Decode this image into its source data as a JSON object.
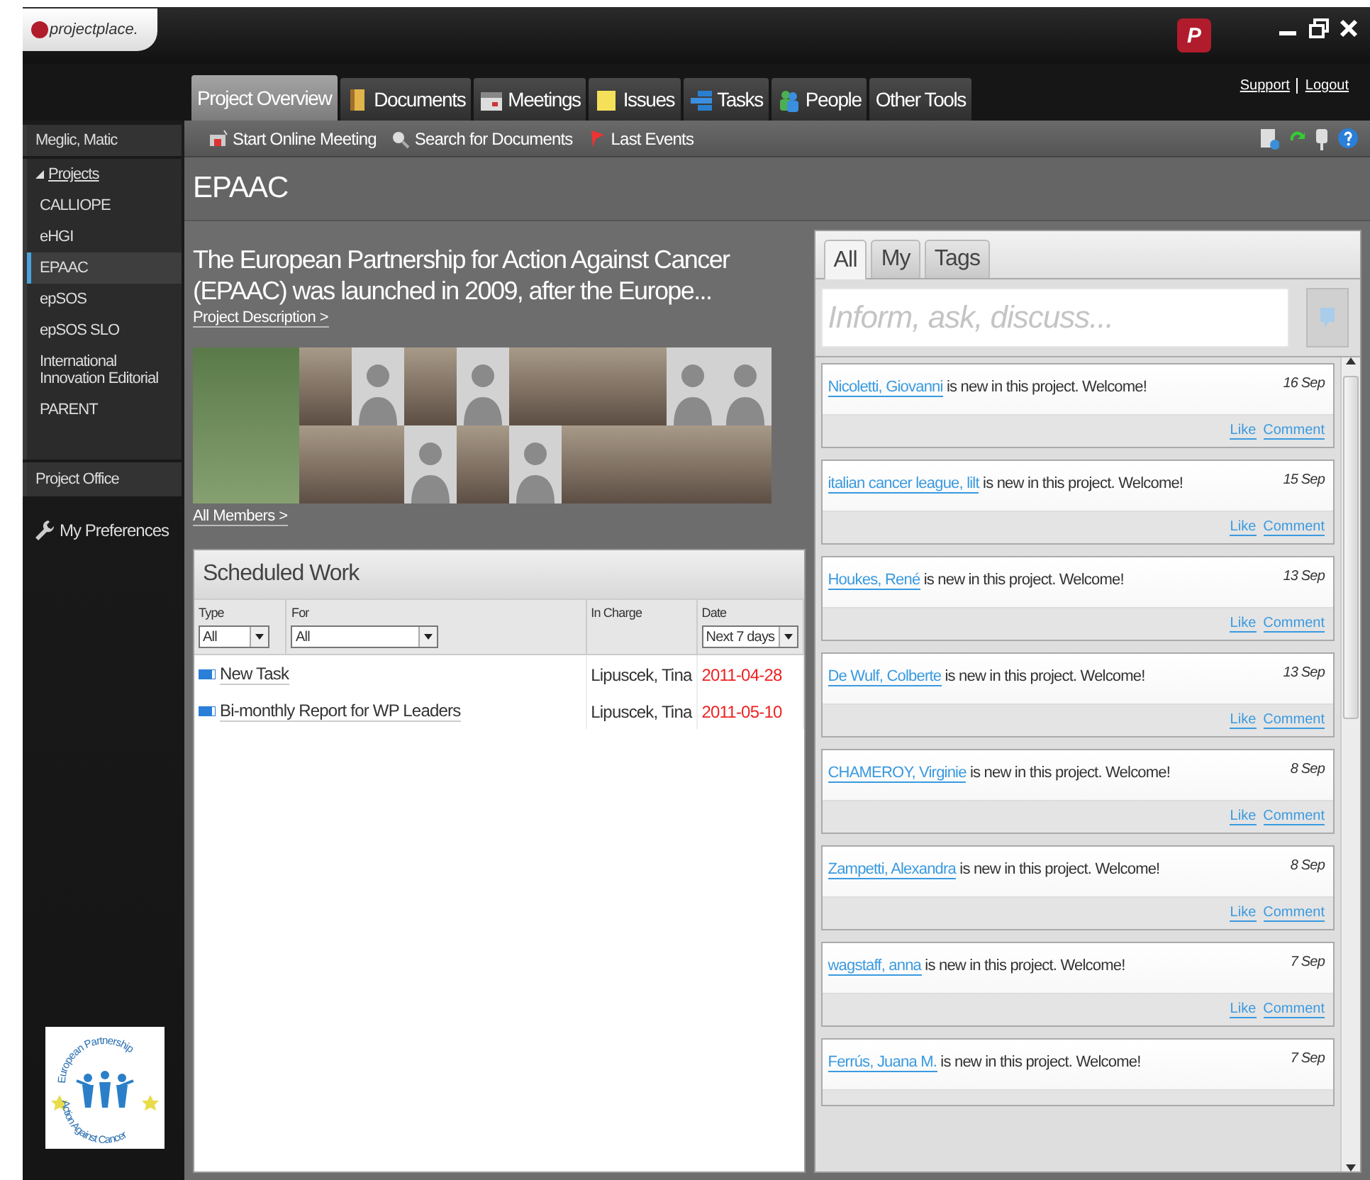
{
  "title_bar": {
    "logo": "projectplace.",
    "app_badge": "P"
  },
  "tabs": [
    {
      "label": "Project Overview",
      "selected": true
    },
    {
      "label": "Documents",
      "selected": false
    },
    {
      "label": "Meetings",
      "selected": false
    },
    {
      "label": "Issues",
      "selected": false
    },
    {
      "label": "Tasks",
      "selected": false
    },
    {
      "label": "People",
      "selected": false
    },
    {
      "label": "Other Tools",
      "selected": false
    }
  ],
  "top_links": [
    "Support",
    "Logout"
  ],
  "sidebar": {
    "user": "Meglic, Matic",
    "projects": {
      "label": "Projects",
      "expanded": true,
      "items": [
        {
          "label": "CALLIOPE",
          "selected": false
        },
        {
          "label": "eHGI",
          "selected": false
        },
        {
          "label": "EPAAC",
          "selected": true
        },
        {
          "label": "epSOS",
          "selected": false
        },
        {
          "label": "epSOS SLO",
          "selected": false
        },
        {
          "label": "International Innovation Editorial",
          "selected": false
        },
        {
          "label": "PARENT",
          "selected": false
        }
      ]
    },
    "project_office": "Project Office",
    "preferences": "My Preferences",
    "logo": {
      "top_text": "European Partnership",
      "bottom_text": "Action Against Cancer"
    }
  },
  "toolbar": {
    "actions": [
      "Start Online Meeting",
      "Search for Documents",
      "Last Events"
    ]
  },
  "project": {
    "title": "EPAAC",
    "description": "The European Partnership for Action Against Cancer (EPAAC) was launched in 2009, after the Europe...",
    "description_link": "Project Description >",
    "members_link": "All Members >",
    "members": [
      {
        "photo": true
      },
      {
        "photo": true
      },
      {
        "photo": false
      },
      {
        "photo": true
      },
      {
        "photo": false
      },
      {
        "photo": true
      },
      {
        "photo": true
      },
      {
        "photo": true
      },
      {
        "photo": false
      },
      {
        "photo": false
      },
      {
        "photo": true
      },
      {
        "photo": true
      },
      {
        "photo": false
      },
      {
        "photo": true
      },
      {
        "photo": false
      },
      {
        "photo": true
      },
      {
        "photo": true
      },
      {
        "photo": true
      },
      {
        "photo": true
      }
    ]
  },
  "scheduled_work": {
    "title": "Scheduled Work",
    "filters": [
      {
        "label": "Type",
        "value": "All"
      },
      {
        "label": "For",
        "value": "All"
      },
      {
        "label": "In Charge"
      },
      {
        "label": "Date",
        "value": "Next 7 days"
      }
    ],
    "rows": [
      {
        "task": "New Task",
        "in_charge": "Lipuscek, Tina",
        "date": "2011-04-28",
        "overdue": true
      },
      {
        "task": "Bi-monthly Report for WP Leaders",
        "in_charge": "Lipuscek, Tina",
        "date": "2011-05-10",
        "overdue": true
      }
    ]
  },
  "feed": {
    "tabs": [
      {
        "label": "All",
        "selected": true
      },
      {
        "label": "My",
        "selected": false
      },
      {
        "label": "Tags",
        "selected": false
      }
    ],
    "placeholder": "Inform, ask, discuss...",
    "posts": [
      {
        "name": "Nicoletti, Giovanni",
        "text": "is new in this project. Welcome!",
        "date": "16 Sep",
        "actions": [
          "Like",
          "Comment"
        ]
      },
      {
        "name": "italian cancer league, lilt",
        "text": "is new in this project. Welcome!",
        "date": "15 Sep",
        "actions": [
          "Like",
          "Comment"
        ]
      },
      {
        "name": "Houkes, René",
        "text": "is new in this project. Welcome!",
        "date": "13 Sep",
        "actions": [
          "Like",
          "Comment"
        ]
      },
      {
        "name": "De Wulf, Colberte",
        "text": "is new in this project. Welcome!",
        "date": "13 Sep",
        "actions": [
          "Like",
          "Comment"
        ]
      },
      {
        "name": "CHAMEROY, Virginie",
        "text": "is new in this project. Welcome!",
        "date": "8 Sep",
        "actions": [
          "Like",
          "Comment"
        ]
      },
      {
        "name": "Zampetti, Alexandra",
        "text": "is new in this project. Welcome!",
        "date": "8 Sep",
        "actions": [
          "Like",
          "Comment"
        ]
      },
      {
        "name": "wagstaff, anna",
        "text": "is new in this project. Welcome!",
        "date": "7 Sep",
        "actions": [
          "Like",
          "Comment"
        ]
      },
      {
        "name": "Ferrús, Juana M.",
        "text": "is new in this project. Welcome!",
        "date": "7 Sep"
      }
    ]
  }
}
